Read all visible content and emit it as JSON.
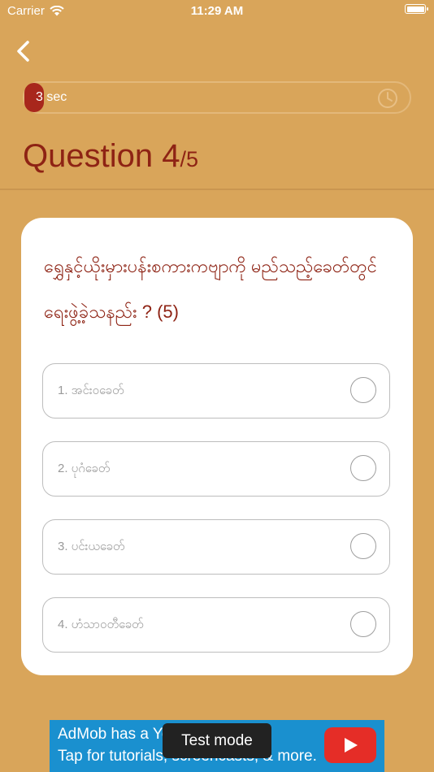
{
  "status_bar": {
    "carrier": "Carrier",
    "time": "11:29 AM"
  },
  "timer": {
    "value_label": "3 sec",
    "fill_fraction": 0.05
  },
  "header": {
    "title_main": "Question 4",
    "title_sub": "/5"
  },
  "question": {
    "text": "ရွှေနှင့်ယိုးမှားပန်းစကားကဗျာကို မည်သည့်ခေတ်တွင် ရေးဖွဲ့ခဲ့သနည်း ? (5)"
  },
  "options": [
    {
      "label": "1. အင်းဝခေတ်"
    },
    {
      "label": "2. ပုဂံခေတ်"
    },
    {
      "label": "3. ပင်းယခေတ်"
    },
    {
      "label": "4. ဟံသာဝတီခေတ်"
    }
  ],
  "ad": {
    "line1": "AdMob has a Yo",
    "line2": "Tap for tutorials, screencasts, & more.",
    "toast": "Test mode"
  },
  "colors": {
    "background": "#d9a55a",
    "accent": "#8e2314",
    "timer_fill": "#a8271c",
    "ad_bg": "#1a90cf"
  },
  "icons": [
    "wifi-icon",
    "battery-icon",
    "back-chevron-icon",
    "clock-icon",
    "play-icon"
  ]
}
